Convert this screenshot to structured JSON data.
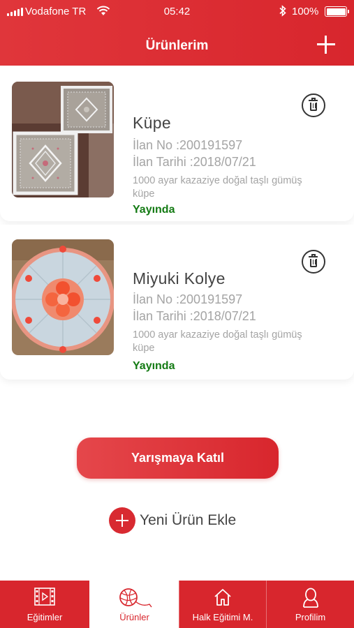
{
  "status_bar": {
    "carrier": "Vodafone TR",
    "time": "05:42",
    "battery": "100%",
    "icons": [
      "signal-icon",
      "wifi-icon",
      "bluetooth-icon",
      "battery-icon"
    ]
  },
  "header": {
    "title": "Ürünlerim",
    "add_icon": "plus-icon"
  },
  "products": [
    {
      "name": "Küpe",
      "listing_no": "İlan No :200191597",
      "listing_date": "İlan Tarihi :2018/07/21",
      "description": "1000 ayar kazaziye doğal taşlı gümüş küpe",
      "status": "Yayında",
      "image": "crochet-doilies-photo",
      "delete_icon": "trash-icon"
    },
    {
      "name": "Miyuki Kolye",
      "listing_no": "İlan No :200191597",
      "listing_date": "İlan Tarihi :2018/07/21",
      "description": "1000 ayar kazaziye doğal taşlı gümüş küpe",
      "status": "Yayında",
      "image": "crochet-round-mat-photo",
      "delete_icon": "trash-icon"
    }
  ],
  "actions": {
    "join_contest": "Yarışmaya Katıl",
    "new_product": "Yeni Ürün Ekle"
  },
  "tabs": [
    {
      "label": "Eğitimler",
      "icon": "film-icon",
      "active": false
    },
    {
      "label": "Ürünler",
      "icon": "yarn-ball-icon",
      "active": true
    },
    {
      "label": "Halk Eğitimi M.",
      "icon": "home-icon",
      "active": false
    },
    {
      "label": "Profilim",
      "icon": "user-icon",
      "active": false
    }
  ],
  "colors": {
    "brand_red": "#d8262d",
    "status_green": "#137a13",
    "muted_text": "#a4a4a4"
  }
}
